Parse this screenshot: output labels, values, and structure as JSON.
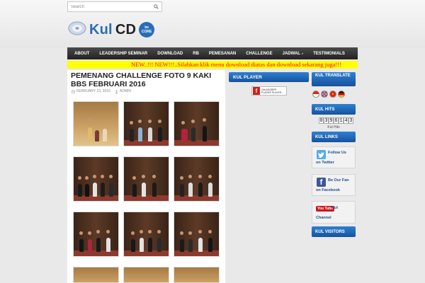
{
  "search": {
    "placeholder": "Search"
  },
  "logo": {
    "kul": "Kul",
    "cd": "CD",
    "badge_top": "be",
    "badge_bottom": "CORE"
  },
  "nav": {
    "items": [
      "ABOUT",
      "LEADERSHIP SEMINAR",
      "DOWNLOAD",
      "RB",
      "PEMESANAN",
      "CHALLENGE",
      "JADWAL",
      "TESTIMONIALS"
    ],
    "jadwal_arrow": "»"
  },
  "marquee": {
    "text": "NEW..!!! NEW!!!..Silahkan klik menu download diatas dan download sekarang juga!!!"
  },
  "post": {
    "title": "PEMENANG CHALLENGE FOTO 9 KAKI BBS FEBRUARI 2016",
    "date": "FEBRUARY 15, 2016",
    "author": "ADMIN"
  },
  "player": {
    "header": "KUL PLAYER",
    "flash_line1": "Get ADOBE®",
    "flash_line2": "FLASH® PLAYER"
  },
  "sidebar": {
    "translate_header": "KUL TRANSLATE",
    "hits_header": "KUL HITS",
    "hits_digits": [
      "0",
      "3",
      "9",
      "6",
      "1",
      "4",
      "3"
    ],
    "hits_label": "Kul Hits",
    "links_header": "KUL LINKS",
    "twitter_line1": "Follow Us",
    "twitter_line2": "on Twitter",
    "facebook_line1": "Be Our Fan",
    "facebook_line2": "on Facebook",
    "youtube_logo": "You Tube",
    "youtube_line1": "Kul",
    "youtube_line2": "Channel",
    "visitors_header": "KUL VISITORS"
  },
  "colors": {
    "accent_blue": "#2a6db5",
    "marquee_bg": "#ffff00",
    "marquee_text": "#ff0000",
    "nav_bg": "#2a2a2a"
  }
}
